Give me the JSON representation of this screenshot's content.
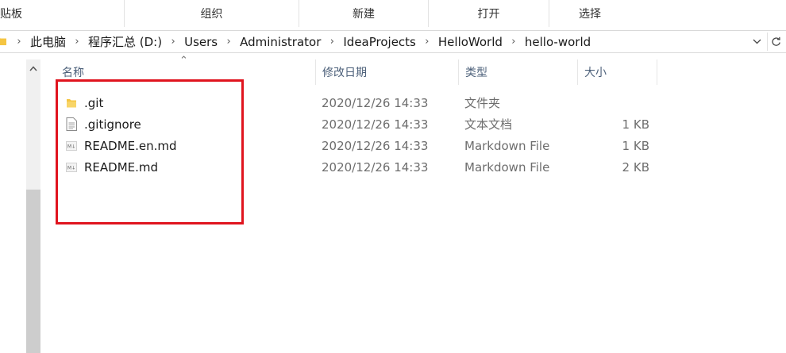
{
  "ribbon": {
    "groups": [
      {
        "label": "贴板"
      },
      {
        "label": "组织"
      },
      {
        "label": "新建"
      },
      {
        "label": "打开"
      },
      {
        "label": "选择"
      }
    ]
  },
  "address_bar": {
    "breadcrumbs": [
      "此电脑",
      "程序汇总 (D:)",
      "Users",
      "Administrator",
      "IdeaProjects",
      "HelloWorld",
      "hello-world"
    ]
  },
  "columns": {
    "name": "名称",
    "date": "修改日期",
    "type": "类型",
    "size": "大小"
  },
  "files": [
    {
      "name": ".git",
      "date": "2020/12/26 14:33",
      "type": "文件夹",
      "size": "",
      "icon": "folder-icon"
    },
    {
      "name": ".gitignore",
      "date": "2020/12/26 14:33",
      "type": "文本文档",
      "size": "1 KB",
      "icon": "text-file-icon"
    },
    {
      "name": "README.en.md",
      "date": "2020/12/26 14:33",
      "type": "Markdown File",
      "size": "1 KB",
      "icon": "markdown-file-icon"
    },
    {
      "name": "README.md",
      "date": "2020/12/26 14:33",
      "type": "Markdown File",
      "size": "2 KB",
      "icon": "markdown-file-icon"
    }
  ],
  "colors": {
    "highlight": "#e0141e",
    "folder": "#f5c542",
    "header_text": "#4c607a"
  }
}
